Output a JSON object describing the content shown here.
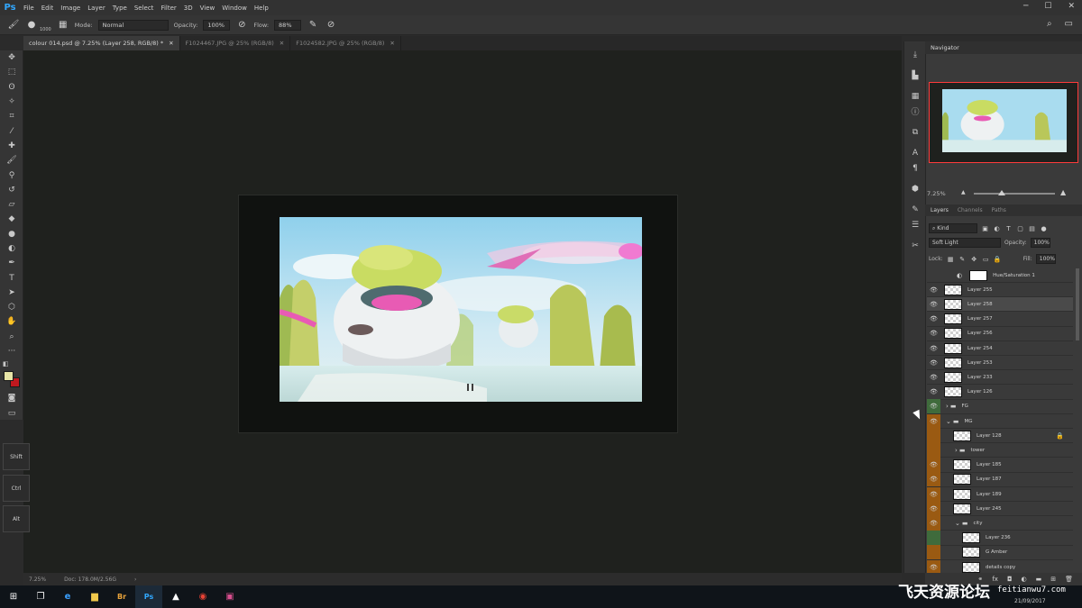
{
  "app": {
    "logo": "Ps"
  },
  "menu": [
    "File",
    "Edit",
    "Image",
    "Layer",
    "Type",
    "Select",
    "Filter",
    "3D",
    "View",
    "Window",
    "Help"
  ],
  "options_bar": {
    "brush_size": "1000",
    "mode_label": "Mode:",
    "mode_value": "Normal",
    "opacity_label": "Opacity:",
    "opacity_value": "100%",
    "flow_label": "Flow:",
    "flow_value": "88%"
  },
  "tabs": [
    {
      "label": "colour 014.psd @ 7.25% (Layer 258, RGB/8) *",
      "active": true
    },
    {
      "label": "F1024467.JPG @ 25% (RGB/8)",
      "active": false
    },
    {
      "label": "F1024582.JPG @ 25% (RGB/8)",
      "active": false
    }
  ],
  "key_buttons": [
    "Shift",
    "Ctrl",
    "Alt"
  ],
  "status": {
    "zoom": "7.25%",
    "doc": "Doc: 178.0M/2.56G"
  },
  "navigator": {
    "title": "Navigator",
    "zoom": "7.25%"
  },
  "layers_panel": {
    "tabs": [
      "Layers",
      "Channels",
      "Paths"
    ],
    "filter": "Kind",
    "blend_mode": "Soft Light",
    "opacity_label": "Opacity:",
    "opacity_value": "100%",
    "lock_label": "Lock:",
    "fill_label": "Fill:",
    "fill_value": "100%"
  },
  "layers": [
    {
      "name": "Hue/Saturation 1",
      "type": "adjustment",
      "visible": false,
      "color": "none"
    },
    {
      "name": "Layer 255",
      "type": "layer",
      "visible": true,
      "color": "none"
    },
    {
      "name": "Layer 258",
      "type": "layer",
      "visible": true,
      "color": "none",
      "selected": true
    },
    {
      "name": "Layer 257",
      "type": "layer",
      "visible": true,
      "color": "none"
    },
    {
      "name": "Layer 256",
      "type": "layer",
      "visible": true,
      "color": "none"
    },
    {
      "name": "Layer 254",
      "type": "layer",
      "visible": true,
      "color": "none"
    },
    {
      "name": "Layer 253",
      "type": "layer",
      "visible": true,
      "color": "none"
    },
    {
      "name": "Layer 233",
      "type": "layer",
      "visible": true,
      "color": "none"
    },
    {
      "name": "Layer 126",
      "type": "layer",
      "visible": true,
      "color": "none"
    },
    {
      "name": "FG",
      "type": "group",
      "visible": true,
      "color": "#3f6b3c"
    },
    {
      "name": "MG",
      "type": "group-open",
      "visible": true,
      "color": "#9a5a12"
    },
    {
      "name": "Layer 128",
      "type": "layer",
      "visible": false,
      "color": "#9a5a12",
      "locked": true
    },
    {
      "name": "tower",
      "type": "group",
      "visible": false,
      "color": "#9a5a12"
    },
    {
      "name": "Layer 185",
      "type": "layer",
      "visible": true,
      "color": "#9a5a12"
    },
    {
      "name": "Layer 187",
      "type": "layer",
      "visible": true,
      "color": "#9a5a12"
    },
    {
      "name": "Layer 189",
      "type": "layer",
      "visible": true,
      "color": "#9a5a12"
    },
    {
      "name": "Layer 245",
      "type": "layer",
      "visible": true,
      "color": "#9a5a12"
    },
    {
      "name": "city",
      "type": "group-open",
      "visible": true,
      "color": "#9a5a12"
    },
    {
      "name": "Layer 236",
      "type": "layer",
      "visible": false,
      "color": "#3f6b3c"
    },
    {
      "name": "G Amber",
      "type": "layer",
      "visible": false,
      "color": "#9a5a12"
    },
    {
      "name": "details copy",
      "type": "layer",
      "visible": true,
      "color": "#9a5a12"
    }
  ],
  "taskbar": {
    "watermark": "飞天资源论坛",
    "watermark_url": "feitianwu7.com",
    "date": "21/09/2017"
  }
}
